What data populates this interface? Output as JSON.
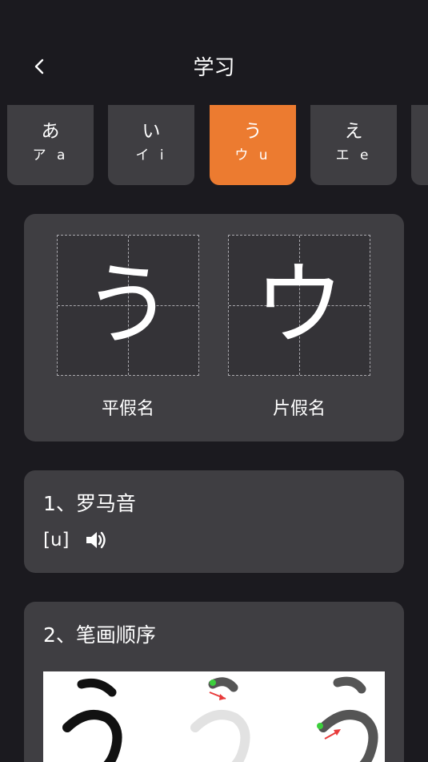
{
  "header": {
    "title": "学习"
  },
  "tabs": [
    {
      "kana": "あ",
      "sub": "ア a",
      "active": false
    },
    {
      "kana": "い",
      "sub": "イ i",
      "active": false
    },
    {
      "kana": "う",
      "sub": "ウ u",
      "active": true
    },
    {
      "kana": "え",
      "sub": "エ e",
      "active": false
    },
    {
      "kana": "",
      "sub": "",
      "active": false
    }
  ],
  "character": {
    "hiragana": "う",
    "katakana": "ウ",
    "hiragana_label": "平假名",
    "katakana_label": "片假名"
  },
  "romaji": {
    "section_title": "1、罗马音",
    "value": "[u]",
    "speaker_icon": "speaker-icon"
  },
  "stroke": {
    "section_title": "2、笔画顺序"
  },
  "colors": {
    "background": "#1b1a1f",
    "card": "#3f3e42",
    "accent": "#ec7b30",
    "text": "#ffffff"
  }
}
